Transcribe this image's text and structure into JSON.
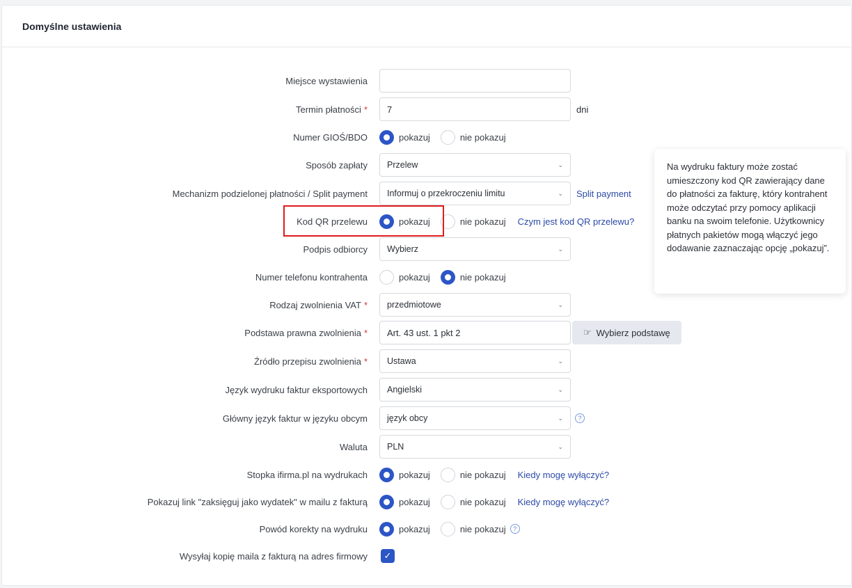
{
  "card": {
    "title": "Domyślne ustawienia"
  },
  "fields": {
    "miejsce": {
      "label": "Miejsce wystawienia",
      "value": ""
    },
    "termin": {
      "label": "Termin płatności",
      "value": "7",
      "suffix": "dni"
    },
    "gios": {
      "label": "Numer GIOŚ/BDO",
      "opt_yes": "pokazuj",
      "opt_no": "nie pokazuj",
      "selected": "pokazuj"
    },
    "sposob": {
      "label": "Sposób zapłaty",
      "value": "Przelew"
    },
    "split": {
      "label": "Mechanizm podzielonej płatności / Split payment",
      "value": "Informuj o przekroczeniu limitu",
      "link": "Split payment"
    },
    "qr": {
      "label": "Kod QR przelewu",
      "opt_yes": "pokazuj",
      "opt_no": "nie pokazuj",
      "selected": "pokazuj",
      "link": "Czym jest kod QR przelewu?"
    },
    "podpis": {
      "label": "Podpis odbiorcy",
      "value": "Wybierz"
    },
    "telefon": {
      "label": "Numer telefonu kontrahenta",
      "opt_yes": "pokazuj",
      "opt_no": "nie pokazuj",
      "selected": "nie pokazuj"
    },
    "rodzaj_vat": {
      "label": "Rodzaj zwolnienia VAT",
      "value": "przedmiotowe"
    },
    "podstawa": {
      "label": "Podstawa prawna zwolnienia",
      "value": "Art. 43 ust. 1 pkt 2",
      "button": "Wybierz podstawę"
    },
    "zrodlo": {
      "label": "Źródło przepisu zwolnienia",
      "value": "Ustawa"
    },
    "jezyk_export": {
      "label": "Język wydruku faktur eksportowych",
      "value": "Angielski"
    },
    "jezyk_obcy": {
      "label": "Główny język faktur w języku obcym",
      "value": "język obcy"
    },
    "waluta": {
      "label": "Waluta",
      "value": "PLN"
    },
    "stopka": {
      "label": "Stopka ifirma.pl na wydrukach",
      "opt_yes": "pokazuj",
      "opt_no": "nie pokazuj",
      "selected": "pokazuj",
      "link": "Kiedy mogę wyłączyć?"
    },
    "link_wydatek": {
      "label": "Pokazuj link \"zaksięguj jako wydatek\" w mailu z fakturą",
      "opt_yes": "pokazuj",
      "opt_no": "nie pokazuj",
      "selected": "pokazuj",
      "link": "Kiedy mogę wyłączyć?"
    },
    "korekta": {
      "label": "Powód korekty na wydruku",
      "opt_yes": "pokazuj",
      "opt_no": "nie pokazuj",
      "selected": "pokazuj"
    },
    "kopia": {
      "label": "Wysyłaj kopię maila z fakturą na adres firmowy",
      "checked": true
    }
  },
  "required_mark": "*",
  "tooltip": {
    "text": "Na wydruku faktury może zostać umieszczony kod QR zawierający dane do płatności za fakturę, który kontrahent może odczytać przy pomocy aplikacji banku na swoim telefonie. Użytkownicy płatnych pakietów mogą włączyć jego dodawanie zaznaczając opcję „pokazuj”."
  },
  "colors": {
    "accent": "#2c55c6",
    "link": "#2c4aa6",
    "required": "#d03a3a",
    "highlight": "#e01b1b"
  }
}
